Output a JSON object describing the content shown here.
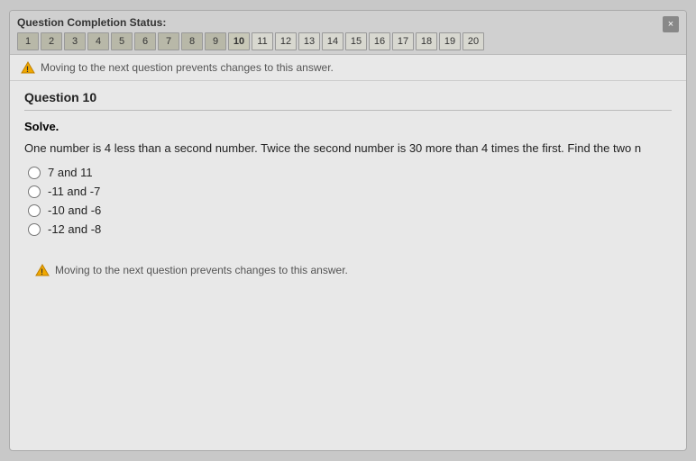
{
  "modal": {
    "close_label": "×"
  },
  "completion_status": {
    "title": "Question Completion Status:",
    "numbers": [
      {
        "label": "1",
        "state": "answered"
      },
      {
        "label": "2",
        "state": "answered"
      },
      {
        "label": "3",
        "state": "answered"
      },
      {
        "label": "4",
        "state": "answered"
      },
      {
        "label": "5",
        "state": "answered"
      },
      {
        "label": "6",
        "state": "answered"
      },
      {
        "label": "7",
        "state": "answered"
      },
      {
        "label": "8",
        "state": "answered"
      },
      {
        "label": "9",
        "state": "answered"
      },
      {
        "label": "10",
        "state": "current"
      },
      {
        "label": "11",
        "state": "normal"
      },
      {
        "label": "12",
        "state": "normal"
      },
      {
        "label": "13",
        "state": "normal"
      },
      {
        "label": "14",
        "state": "normal"
      },
      {
        "label": "15",
        "state": "normal"
      },
      {
        "label": "16",
        "state": "normal"
      },
      {
        "label": "17",
        "state": "normal"
      },
      {
        "label": "18",
        "state": "normal"
      },
      {
        "label": "19",
        "state": "normal"
      },
      {
        "label": "20",
        "state": "normal"
      }
    ]
  },
  "warning": {
    "top_text": "Moving to the next question prevents changes to this answer.",
    "bottom_text": "Moving to the next question prevents changes to this answer."
  },
  "question": {
    "header": "Question 10",
    "instruction": "Solve.",
    "text": "One number is 4 less than a second number. Twice the second number is 30 more than 4 times the first. Find the two n",
    "options": [
      {
        "label": "7 and 11",
        "value": "a"
      },
      {
        "label": "-11 and -7",
        "value": "b"
      },
      {
        "label": "-10 and -6",
        "value": "c"
      },
      {
        "label": "-12 and -8",
        "value": "d"
      }
    ]
  }
}
